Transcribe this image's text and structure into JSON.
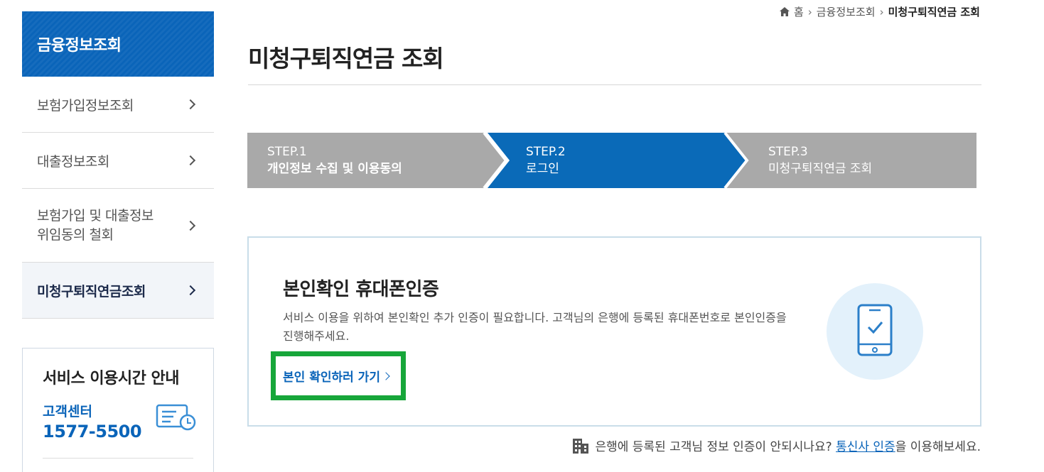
{
  "sidebar": {
    "header": "금융정보조회",
    "items": [
      {
        "label": "보험가입정보조회"
      },
      {
        "label": "대출정보조회"
      },
      {
        "label": "보험가입 및 대출정보\n위임동의 철회"
      },
      {
        "label": "미청구퇴직연금조회"
      }
    ],
    "service": {
      "title": "서비스 이용시간 안내",
      "center_label": "고객센터",
      "phone": "1577-5500"
    }
  },
  "breadcrumb": {
    "home": "홈",
    "level1": "금융정보조회",
    "current": "미청구퇴직연금 조회"
  },
  "page_title": "미청구퇴직연금 조회",
  "steps": [
    {
      "num": "STEP.1",
      "name": "개인정보 수집 및 이용동의",
      "active": false
    },
    {
      "num": "STEP.2",
      "name": "로그인",
      "active": true
    },
    {
      "num": "STEP.3",
      "name": "미청구퇴직연금 조회",
      "active": false
    }
  ],
  "auth": {
    "title": "본인확인 휴대폰인증",
    "description": "서비스 이용을 위하여 본인확인 추가 인증이 필요합니다. 고객님의 은행에 등록된 휴대폰번호로 본인인증을 진행해주세요.",
    "button_label": "본인 확인하러 가기"
  },
  "footnote": {
    "before": "은행에 등록된 고객님 정보 인증이 안되시나요?",
    "link": "통신사 인증",
    "after": "을 이용해보세요."
  },
  "colors": {
    "brand": "#0a64b9",
    "step_inactive": "#a9a9a9",
    "highlight_border": "#17a63a"
  }
}
